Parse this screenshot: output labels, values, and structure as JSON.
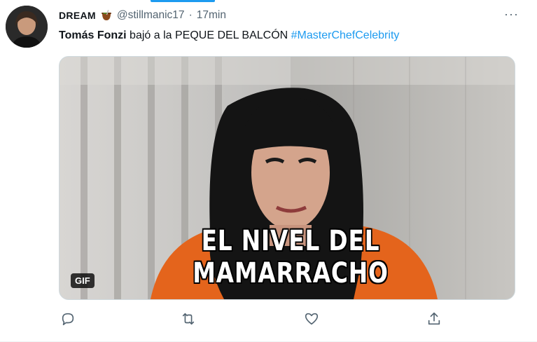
{
  "tweet": {
    "display_name": "DREAM",
    "name_emoji_icon": "mate-cup-icon",
    "handle": "@stillmanic17",
    "separator": "·",
    "time": "17min",
    "more_label": "···",
    "text": {
      "mention": "Tomás Fonzi",
      "body": " bajó a la PEQUE DEL BALCÓN ",
      "hashtag": "#MasterChefCelebrity"
    },
    "media": {
      "badge": "GIF",
      "caption": "EL NIVEL DEL MAMARRACHO"
    },
    "actions": [
      {
        "icon": "reply-icon"
      },
      {
        "icon": "retweet-icon"
      },
      {
        "icon": "like-icon"
      },
      {
        "icon": "share-icon"
      }
    ]
  },
  "colors": {
    "accent": "#1d9bf0",
    "secondary_text": "#536471",
    "primary_text": "#0f1419"
  }
}
